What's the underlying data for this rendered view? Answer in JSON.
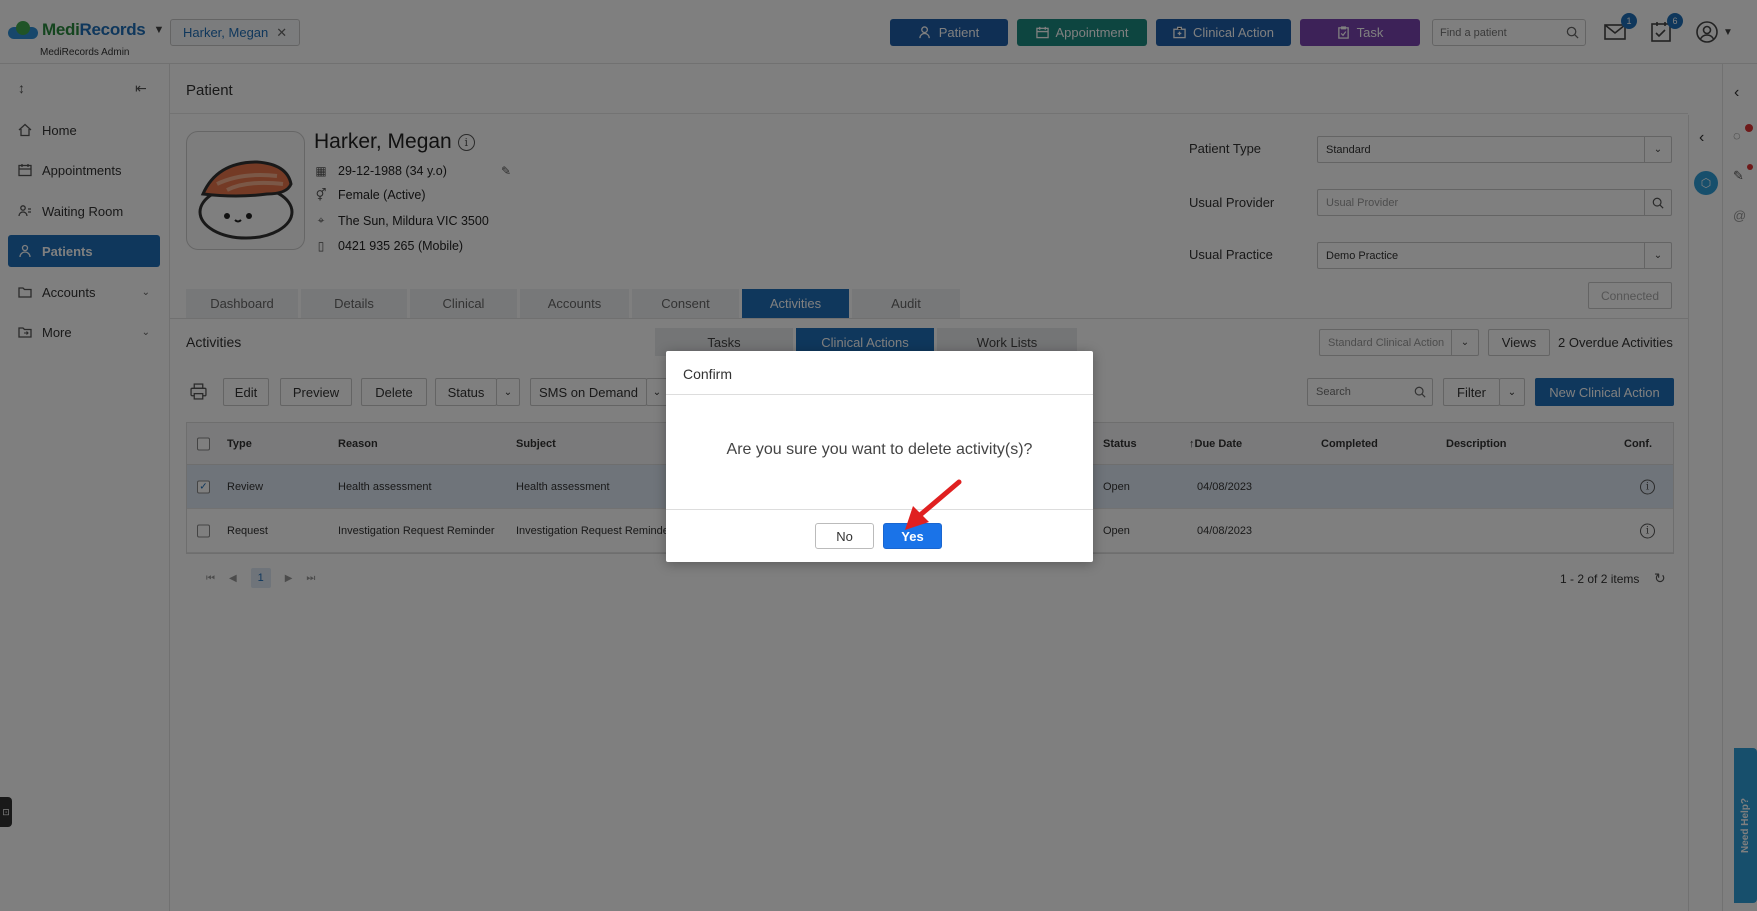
{
  "app": {
    "brand_medi": "Medi",
    "brand_records": "Records",
    "subtitle": "MediRecords Admin"
  },
  "open_patient_chip": "Harker, Megan",
  "top_buttons": [
    {
      "label": "Patient",
      "color": "#1f5fa8"
    },
    {
      "label": "Appointment",
      "color": "#1b8a80"
    },
    {
      "label": "Clinical Action",
      "color": "#1f5fa8"
    },
    {
      "label": "Task",
      "color": "#7b45b0"
    }
  ],
  "find_patient_placeholder": "Find a patient",
  "mail_badge": "1",
  "tasks_badge": "6",
  "sidebar": {
    "items": [
      {
        "label": "Home"
      },
      {
        "label": "Appointments"
      },
      {
        "label": "Waiting Room"
      },
      {
        "label": "Patients"
      },
      {
        "label": "Accounts"
      },
      {
        "label": "More"
      }
    ]
  },
  "page_title": "Patient",
  "patient": {
    "name": "Harker, Megan",
    "dob": "29-12-1988 (34 y.o)",
    "gender": "Female (Active)",
    "address": "The Sun, Mildura VIC 3500",
    "phone": "0421 935 265 (Mobile)"
  },
  "fields": {
    "patient_type_label": "Patient Type",
    "patient_type_value": "Standard",
    "usual_provider_label": "Usual Provider",
    "usual_provider_placeholder": "Usual Provider",
    "usual_practice_label": "Usual Practice",
    "usual_practice_value": "Demo Practice",
    "connected_label": "Connected"
  },
  "tabs": [
    "Dashboard",
    "Details",
    "Clinical",
    "Accounts",
    "Consent",
    "Activities",
    "Audit"
  ],
  "activities": {
    "title": "Activities",
    "subtabs": [
      "Tasks",
      "Clinical Actions",
      "Work Lists"
    ],
    "view_select": "Standard Clinical Action",
    "views_label": "Views",
    "overdue_label": "2 Overdue Activities",
    "toolbar": {
      "edit": "Edit",
      "preview": "Preview",
      "delete": "Delete",
      "status": "Status",
      "sms": "SMS on Demand",
      "search_placeholder": "Search",
      "filter": "Filter",
      "new_action": "New Clinical Action"
    },
    "columns": [
      "Type",
      "Reason",
      "Subject",
      "Status",
      "Due Date",
      "Completed",
      "Description",
      "Conf."
    ],
    "rows": [
      {
        "type": "Review",
        "reason": "Health assessment",
        "subject": "Health assessment",
        "status": "Open",
        "due": "04/08/2023",
        "checked": "✓"
      },
      {
        "type": "Request",
        "reason": "Investigation Request Reminder",
        "subject": "Investigation Request Reminde",
        "status": "Open",
        "due": "04/08/2023",
        "checked": ""
      }
    ],
    "current_page": "1",
    "items_count": "1 - 2 of 2 items"
  },
  "need_help": "Need Help?",
  "modal": {
    "title": "Confirm",
    "message": "Are you sure you want to delete activity(s)?",
    "no": "No",
    "yes": "Yes"
  }
}
